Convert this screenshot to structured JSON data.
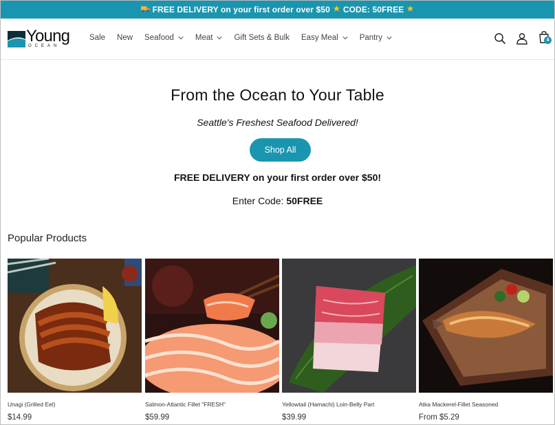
{
  "announcement": {
    "truck_icon": "delivery-truck-icon",
    "text": "FREE DELIVERY on your first order over $50",
    "star_icon": "star-icon",
    "code_text": "CODE: 50FREE"
  },
  "brand": {
    "name": "Young",
    "tagline": "OCEAN",
    "colors": {
      "accent": "#1a95b0",
      "logo_dark": "#0c2d3a"
    }
  },
  "nav": {
    "items": [
      {
        "label": "Sale",
        "has_dropdown": false
      },
      {
        "label": "New",
        "has_dropdown": false
      },
      {
        "label": "Seafood",
        "has_dropdown": true
      },
      {
        "label": "Meat",
        "has_dropdown": true
      },
      {
        "label": "Gift Sets & Bulk",
        "has_dropdown": false
      },
      {
        "label": "Easy Meal",
        "has_dropdown": true
      },
      {
        "label": "Pantry",
        "has_dropdown": true
      }
    ]
  },
  "header_icons": {
    "search": "search-icon",
    "account": "user-icon",
    "cart": "shopping-bag-icon",
    "cart_count": "4"
  },
  "hero": {
    "title": "From the Ocean to Your Table",
    "subtitle": "Seattle's Freshest Seafood Delivered!",
    "button_label": "Shop All",
    "promo": "FREE DELIVERY on your first order over $50!",
    "code_label": "Enter Code:",
    "code_value": "50FREE"
  },
  "popular": {
    "title": "Popular Products",
    "products": [
      {
        "name": "Unagi (Grilled Eel)",
        "price": "$14.99"
      },
      {
        "name": "Salmon-Atlantic Fillet \"FRESH\"",
        "price": "$59.99"
      },
      {
        "name": "Yellowtail (Hamachi) Loin-Belly Part",
        "price": "$39.99"
      },
      {
        "name": "Atka Mackerel-Fillet Seasoned",
        "price": "From $5.29"
      }
    ]
  }
}
